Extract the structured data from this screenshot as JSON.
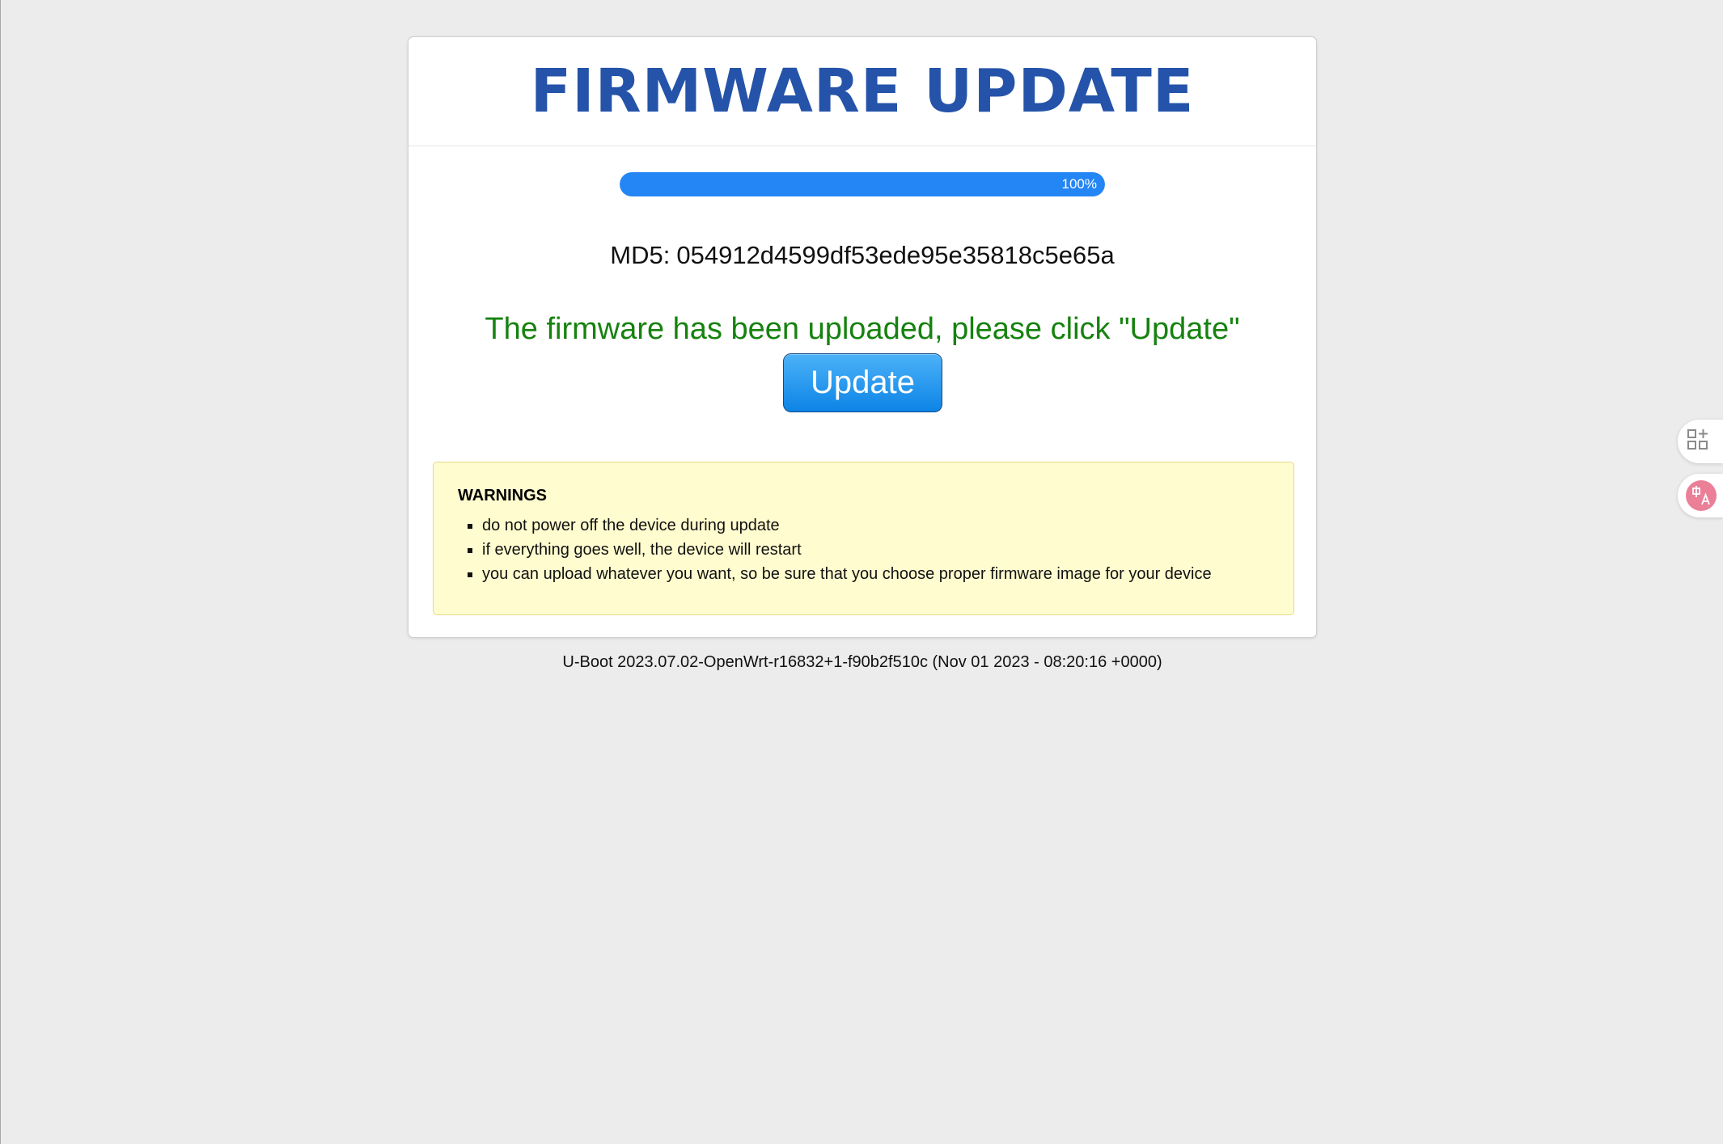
{
  "page": {
    "title": "FIRMWARE UPDATE",
    "progress": {
      "value_percent": 100,
      "label": "100%",
      "color": "#2486f5"
    },
    "md5": {
      "label": "MD5:",
      "value": "054912d4599df53ede95e35818c5e65a"
    },
    "message": "The firmware has been uploaded, please click \"Update\"",
    "update_button_label": "Update",
    "warnings": {
      "title": "WARNINGS",
      "items": [
        "do not power off the device during update",
        "if everything goes well, the device will restart",
        "you can upload whatever you want, so be sure that you choose proper firmware image for your device"
      ]
    },
    "footer": "U-Boot 2023.07.02-OpenWrt-r16832+1-f90b2f510c (Nov 01 2023 - 08:20:16 +0000)"
  },
  "side_tools": [
    {
      "icon": "apps-add-icon"
    },
    {
      "icon": "translate-icon"
    }
  ],
  "colors": {
    "title": "#2453a9",
    "message": "#16820f",
    "warning_bg": "#fffccf",
    "button": "#1b8ff0"
  }
}
